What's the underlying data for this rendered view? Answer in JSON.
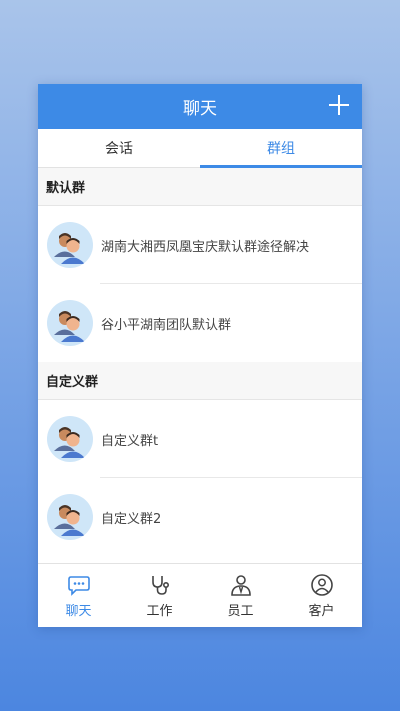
{
  "header": {
    "title": "聊天"
  },
  "tabs": [
    {
      "label": "会话",
      "active": false
    },
    {
      "label": "群组",
      "active": true
    }
  ],
  "sections": [
    {
      "title": "默认群",
      "items": [
        {
          "name": "湖南大湘西凤凰宝庆默认群途径解决"
        },
        {
          "name": "谷小平湖南团队默认群"
        }
      ]
    },
    {
      "title": "自定义群",
      "items": [
        {
          "name": "自定义群t"
        },
        {
          "name": "自定义群2"
        }
      ]
    }
  ],
  "bottom_nav": [
    {
      "label": "聊天",
      "icon": "chat-bubble-icon",
      "active": true
    },
    {
      "label": "工作",
      "icon": "stethoscope-icon",
      "active": false
    },
    {
      "label": "员工",
      "icon": "employee-icon",
      "active": false
    },
    {
      "label": "客户",
      "icon": "customer-icon",
      "active": false
    }
  ],
  "colors": {
    "accent": "#3d8ae6",
    "avatar_bg": "#cfe6f8"
  }
}
